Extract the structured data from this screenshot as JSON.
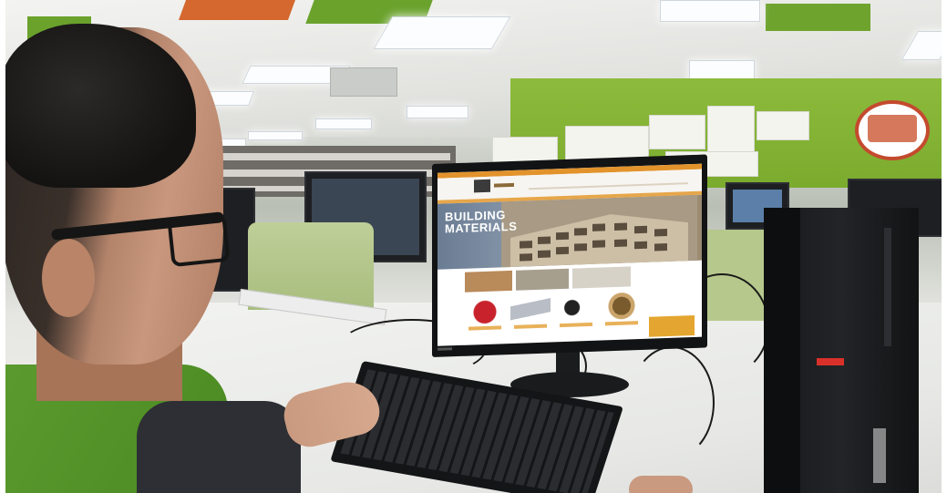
{
  "scene": {
    "description_label": "",
    "monitor_webpage": {
      "hero_title": "BUILDING\nMATERIALS"
    }
  },
  "colors": {
    "wall_green": "#8dbb3c",
    "site_accent": "#e2932c",
    "cta_yellow": "#e4a630",
    "tower_badge": "#d9312a"
  }
}
